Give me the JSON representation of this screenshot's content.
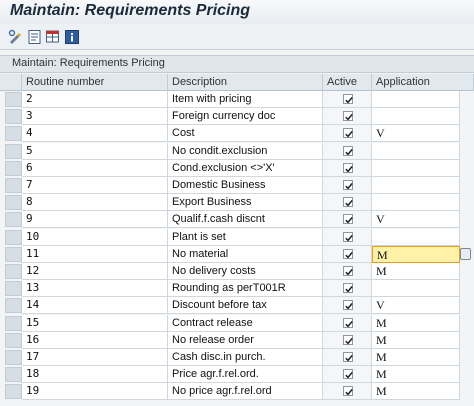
{
  "window": {
    "title": "Maintain: Requirements Pricing"
  },
  "toolbar": {
    "icons": [
      "change-display-icon",
      "display-changes-icon",
      "table-settings-icon",
      "info-icon"
    ]
  },
  "panel": {
    "title": "Maintain: Requirements Pricing"
  },
  "table": {
    "headers": {
      "routine": "Routine number",
      "description": "Description",
      "active": "Active",
      "application": "Application"
    },
    "rows": [
      {
        "routine": "2",
        "description": "Item with pricing",
        "active": true,
        "application": ""
      },
      {
        "routine": "3",
        "description": "Foreign currency doc",
        "active": true,
        "application": ""
      },
      {
        "routine": "4",
        "description": "Cost",
        "active": true,
        "application": "V"
      },
      {
        "routine": "5",
        "description": "No condit.exclusion",
        "active": true,
        "application": ""
      },
      {
        "routine": "6",
        "description": "Cond.exclusion <>'X'",
        "active": true,
        "application": ""
      },
      {
        "routine": "7",
        "description": "Domestic Business",
        "active": true,
        "application": ""
      },
      {
        "routine": "8",
        "description": "Export Business",
        "active": true,
        "application": ""
      },
      {
        "routine": "9",
        "description": "Qualif.f.cash discnt",
        "active": true,
        "application": "V"
      },
      {
        "routine": "10",
        "description": "Plant is set",
        "active": true,
        "application": ""
      },
      {
        "routine": "11",
        "description": "No material",
        "active": true,
        "application": "M"
      },
      {
        "routine": "12",
        "description": "No delivery costs",
        "active": true,
        "application": "M"
      },
      {
        "routine": "13",
        "description": "Rounding as perT001R",
        "active": true,
        "application": ""
      },
      {
        "routine": "14",
        "description": "Discount before tax",
        "active": true,
        "application": "V"
      },
      {
        "routine": "15",
        "description": "Contract release",
        "active": true,
        "application": "M"
      },
      {
        "routine": "16",
        "description": "No release order",
        "active": true,
        "application": "M"
      },
      {
        "routine": "17",
        "description": "Cash disc.in purch.",
        "active": true,
        "application": "M"
      },
      {
        "routine": "18",
        "description": "Price agr.f.rel.ord.",
        "active": true,
        "application": "M"
      },
      {
        "routine": "19",
        "description": "No price agr.f.rel.ord",
        "active": true,
        "application": "M"
      }
    ],
    "focused_row_routine": "11"
  },
  "colors": {
    "title": "#1c2b3c",
    "header_bg": "#e1e8ee",
    "focus_bg": "#fff2a8",
    "focus_border": "#e0a020"
  }
}
